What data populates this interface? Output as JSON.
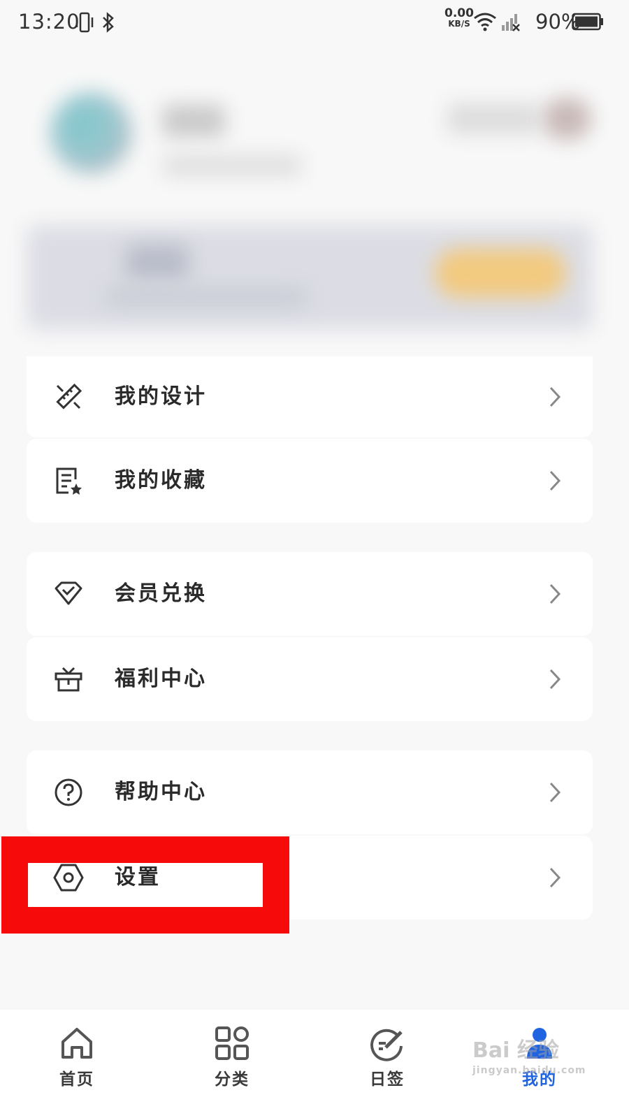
{
  "status_bar": {
    "time": "13:20",
    "net_speed_value": "0.00",
    "net_speed_unit": "KB/S",
    "battery_percent": "90%",
    "icons": [
      "vibrate-icon",
      "bluetooth-icon",
      "wifi-icon",
      "signal-no-service-icon",
      "battery-icon"
    ]
  },
  "menu": {
    "group1": [
      {
        "label": "我的设计",
        "icon": "design-ruler-icon"
      },
      {
        "label": "我的收藏",
        "icon": "favorites-list-icon"
      }
    ],
    "group2": [
      {
        "label": "会员兑换",
        "icon": "diamond-icon"
      },
      {
        "label": "福利中心",
        "icon": "gift-icon"
      }
    ],
    "group3": [
      {
        "label": "帮助中心",
        "icon": "help-icon"
      },
      {
        "label": "设置",
        "icon": "settings-hexagon-icon"
      }
    ]
  },
  "bottom_nav": {
    "items": [
      {
        "label": "首页",
        "icon": "home-icon"
      },
      {
        "label": "分类",
        "icon": "category-grid-icon"
      },
      {
        "label": "日签",
        "icon": "daily-sign-icon"
      },
      {
        "label": "我的",
        "icon": "profile-icon",
        "active": true
      }
    ],
    "active_color": "#1f63e0"
  },
  "watermark": {
    "text": "Bai 经验",
    "sub": "jingyan.baidu.com"
  },
  "colors": {
    "highlight": "#f70a0a",
    "background": "#f8f8f8",
    "vip_button": "#f2c97f"
  }
}
